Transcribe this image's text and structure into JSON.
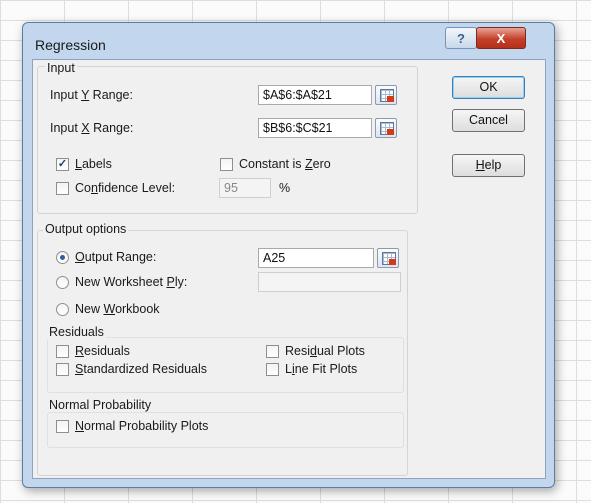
{
  "dialog": {
    "title": "Regression",
    "help_glyph": "?",
    "close_glyph": "X"
  },
  "input": {
    "group_label": "Input",
    "y_range_label": [
      "Input ",
      "Y",
      " Range:"
    ],
    "y_range_value": "$A$6:$A$21",
    "x_range_label": [
      "Input ",
      "X",
      " Range:"
    ],
    "x_range_value": "$B$6:$C$21",
    "labels": {
      "label": [
        "",
        "L",
        "abels"
      ],
      "checked": true
    },
    "constant_zero": {
      "label": [
        "Constant is ",
        "Z",
        "ero"
      ],
      "checked": false
    },
    "confidence": {
      "label": [
        "Co",
        "n",
        "fidence Level:"
      ],
      "checked": false,
      "value": "95",
      "unit": "%"
    }
  },
  "output": {
    "group_label": "Output options",
    "output_range": {
      "label": [
        "",
        "O",
        "utput Range:"
      ],
      "selected": true,
      "value": "A25"
    },
    "new_ply": {
      "label": [
        "New Worksheet ",
        "P",
        "ly:"
      ],
      "selected": false,
      "value": ""
    },
    "new_workbook": {
      "label": [
        "New ",
        "W",
        "orkbook"
      ],
      "selected": false
    }
  },
  "residuals": {
    "group_label": "Residuals",
    "residuals": {
      "label": [
        "",
        "R",
        "esiduals"
      ],
      "checked": false
    },
    "standardized": {
      "label": [
        "",
        "S",
        "tandardized Residuals"
      ],
      "checked": false
    },
    "residual_plots": {
      "label": [
        "Resi",
        "d",
        "ual Plots"
      ],
      "checked": false
    },
    "line_fit_plots": {
      "label": [
        "L",
        "i",
        "ne Fit Plots"
      ],
      "checked": false
    }
  },
  "normal": {
    "group_label": "Normal Probability",
    "plots": {
      "label": [
        "",
        "N",
        "ormal Probability Plots"
      ],
      "checked": false
    }
  },
  "buttons": {
    "ok": "OK",
    "cancel": "Cancel",
    "help": [
      "",
      "H",
      "elp"
    ]
  },
  "icons": {
    "range_button": "range-select-icon",
    "check_mark": "✓"
  },
  "colors": {
    "frame": "#c2d7ee",
    "close_button": "#c4402a",
    "client": "#f0f0f0"
  }
}
